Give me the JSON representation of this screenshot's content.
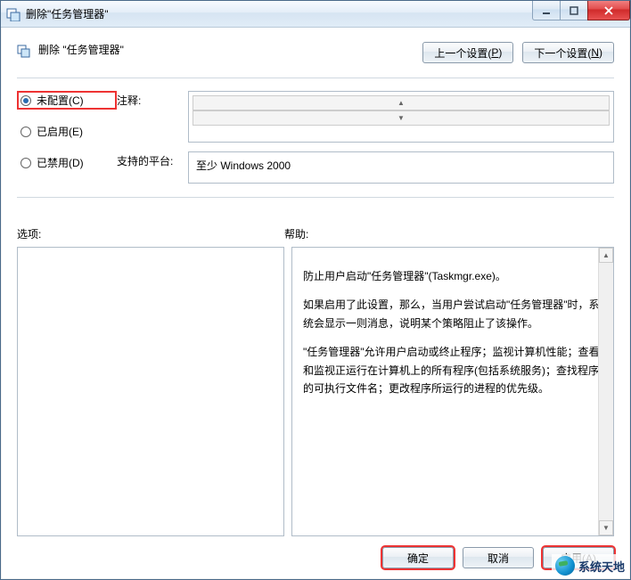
{
  "window": {
    "title": "删除\"任务管理器\""
  },
  "header": {
    "title": "删除 \"任务管理器\"",
    "prev_btn": "上一个设置(P)",
    "next_btn": "下一个设置(N)"
  },
  "radios": {
    "not_configured": "未配置(C)",
    "enabled": "已启用(E)",
    "disabled": "已禁用(D)"
  },
  "info": {
    "comment_label": "注释:",
    "comment_value": "",
    "platform_label": "支持的平台:",
    "platform_value": "至少 Windows 2000"
  },
  "labels": {
    "options": "选项:",
    "help": "帮助:"
  },
  "help": {
    "p1": "防止用户启动\"任务管理器\"(Taskmgr.exe)。",
    "p2": "如果启用了此设置，那么，当用户尝试启动\"任务管理器\"时，系统会显示一则消息，说明某个策略阻止了该操作。",
    "p3": "\"任务管理器\"允许用户启动或终止程序；监视计算机性能；查看和监视正运行在计算机上的所有程序(包括系统服务)；查找程序的可执行文件名；更改程序所运行的进程的优先级。"
  },
  "footer": {
    "ok": "确定",
    "cancel": "取消",
    "apply": "应用(A)"
  },
  "watermark": {
    "text": "系统天地"
  }
}
